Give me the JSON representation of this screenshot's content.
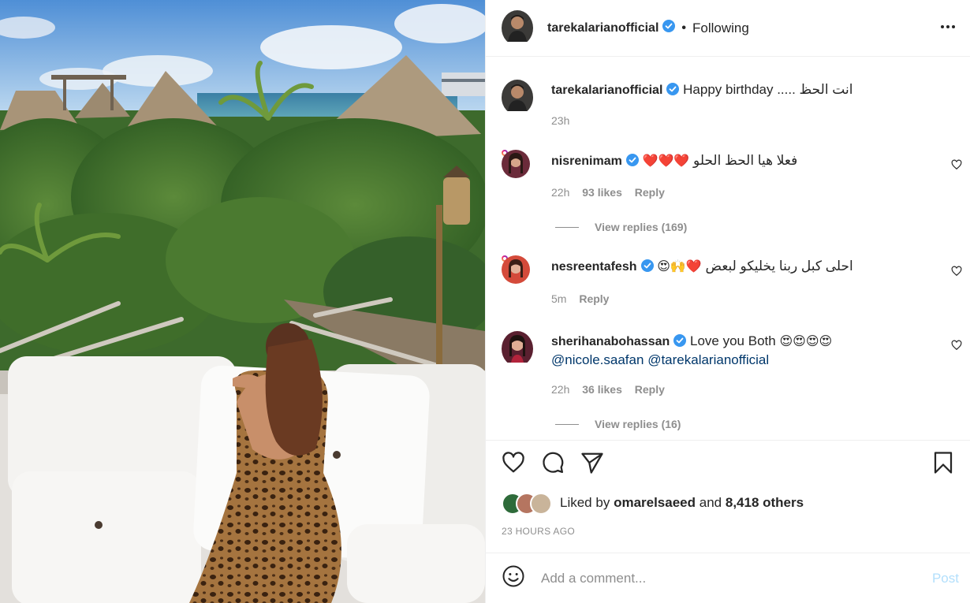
{
  "post": {
    "author": "tarekalarianofficial",
    "follow_state": "Following",
    "dot": "•"
  },
  "caption": {
    "username": "tarekalarianofficial",
    "text": "Happy birthday ..... انت الحظ",
    "time": "23h"
  },
  "comments": [
    {
      "username": "nisrenimam",
      "text": "فعلا هيا الحظ الحلو",
      "emoji": "❤️❤️❤️",
      "time": "22h",
      "likes": "93 likes",
      "reply": "Reply",
      "view_replies": "View replies (169)"
    },
    {
      "username": "nesreentafesh",
      "text": "احلى كبل ربنا يخليكو لبعض",
      "emoji": "😍🙌❤️",
      "time": "5m",
      "reply": "Reply"
    },
    {
      "username": "sherihanabohassan",
      "text": "Love you Both",
      "emoji": "😍😍😍😍",
      "mention1": "@nicole.saafan",
      "mention2": "@tarekalarianofficial",
      "time": "22h",
      "likes": "36 likes",
      "reply": "Reply",
      "view_replies": "View replies (16)"
    }
  ],
  "likes_line": {
    "prefix": "Liked by",
    "user": "omarelsaeed",
    "and": "and",
    "others": "8,418 others"
  },
  "timestamp": "23 HOURS AGO",
  "add_comment": {
    "placeholder": "Add a comment...",
    "post_label": "Post"
  },
  "colors": {
    "verified": "#3897f0",
    "heart_red": "#ed4956",
    "post_disabled": "#b2dffc",
    "mention": "#00376b"
  }
}
